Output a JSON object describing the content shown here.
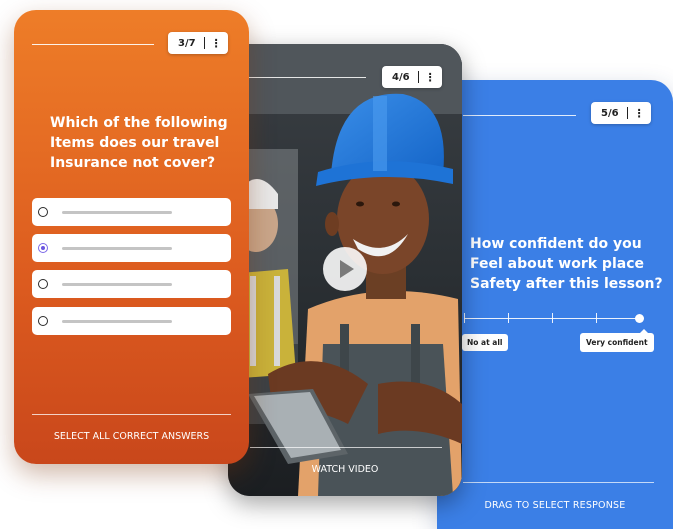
{
  "blue_card": {
    "counter": "5/6",
    "question": "How confident do you Feel about work place Safety after this lesson?",
    "slider": {
      "min_label": "No at all",
      "max_label": "Very confident",
      "value_fraction": 1.0
    },
    "footer": "DRAG TO SELECT RESPONSE",
    "color": "#3b7fe6"
  },
  "video_card": {
    "counter": "4/6",
    "footer": "WATCH VIDEO",
    "play_icon": "play-icon"
  },
  "orange_card": {
    "counter": "3/7",
    "question": "Which of the following Items does our travel Insurance not cover?",
    "options": [
      {
        "selected": false
      },
      {
        "selected": true
      },
      {
        "selected": false
      },
      {
        "selected": false
      }
    ],
    "footer": "SELECT ALL CORRECT ANSWERS",
    "color": "#e4692a"
  },
  "menu_icon": "kebab-menu-icon"
}
